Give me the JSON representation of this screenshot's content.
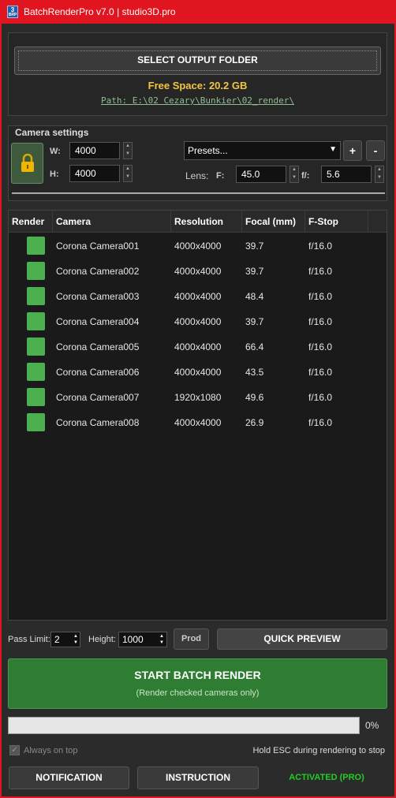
{
  "window": {
    "title": "BatchRenderPro v7.0 | studio3D.pro",
    "icon_text": "3",
    "icon_subtext": "BRP"
  },
  "output": {
    "select_label": "SELECT OUTPUT FOLDER",
    "free_space": "Free Space: 20.2 GB",
    "path": "Path: E:\\02 Cezary\\Bunkier\\02_render\\"
  },
  "camera_settings": {
    "title": "Camera settings",
    "width_label": "W:",
    "width_value": "4000",
    "height_label": "H:",
    "height_value": "4000",
    "presets_value": "Presets...",
    "add_label": "+",
    "remove_label": "-",
    "lens_label": "Lens:",
    "focal_label": "F:",
    "focal_value": "45.0",
    "fstop_label": "f/:",
    "fstop_value": "5.6"
  },
  "table": {
    "headers": [
      "Render",
      "Camera",
      "Resolution",
      "Focal (mm)",
      "F-Stop"
    ],
    "rows": [
      {
        "checked": true,
        "camera": "Corona Camera001",
        "resolution": "4000x4000",
        "focal": "39.7",
        "fstop": "f/16.0"
      },
      {
        "checked": true,
        "camera": "Corona Camera002",
        "resolution": "4000x4000",
        "focal": "39.7",
        "fstop": "f/16.0"
      },
      {
        "checked": true,
        "camera": "Corona Camera003",
        "resolution": "4000x4000",
        "focal": "48.4",
        "fstop": "f/16.0"
      },
      {
        "checked": true,
        "camera": "Corona Camera004",
        "resolution": "4000x4000",
        "focal": "39.7",
        "fstop": "f/16.0"
      },
      {
        "checked": true,
        "camera": "Corona Camera005",
        "resolution": "4000x4000",
        "focal": "66.4",
        "fstop": "f/16.0"
      },
      {
        "checked": true,
        "camera": "Corona Camera006",
        "resolution": "4000x4000",
        "focal": "43.5",
        "fstop": "f/16.0"
      },
      {
        "checked": true,
        "camera": "Corona Camera007",
        "resolution": "1920x1080",
        "focal": "49.6",
        "fstop": "f/16.0"
      },
      {
        "checked": true,
        "camera": "Corona Camera008",
        "resolution": "4000x4000",
        "focal": "26.9",
        "fstop": "f/16.0"
      }
    ]
  },
  "preview": {
    "pass_limit_label": "Pass Limit:",
    "pass_limit_value": "2",
    "height_label": "Height:",
    "height_value": "1000",
    "prod_label": "Prod",
    "quick_preview_label": "QUICK PREVIEW"
  },
  "render": {
    "start_label": "START BATCH RENDER",
    "start_sub": "(Render checked cameras only)",
    "progress_percent": 0,
    "progress_text": "0%"
  },
  "footer": {
    "always_on_top": "Always on top",
    "always_on_top_checked": true,
    "esc_hint": "Hold ESC during rendering to stop",
    "notification_label": "NOTIFICATION",
    "instruction_label": "INSTRUCTION",
    "activated_label": "ACTIVATED (PRO)"
  },
  "colors": {
    "title_bar": "#e1151f",
    "accent_yellow": "#f5c542",
    "checkbox_green": "#4caf50",
    "start_green": "#2e7d32",
    "activated_green": "#22cc22",
    "path_green": "#8fbf8f"
  }
}
